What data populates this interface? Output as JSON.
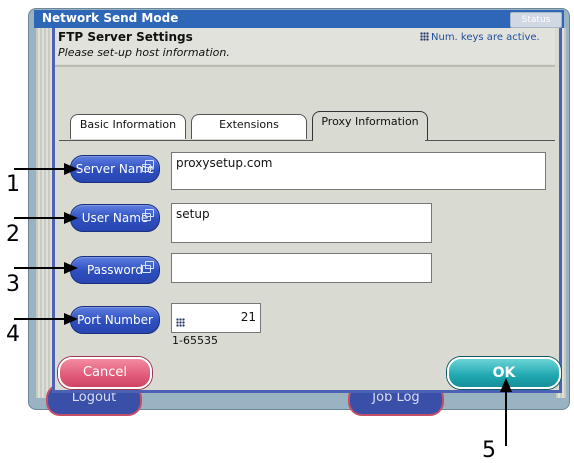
{
  "window": {
    "title": "Network Send Mode",
    "status_label": "Status"
  },
  "dialog": {
    "title": "FTP Server Settings",
    "subtitle": "Please set-up host information.",
    "num_keys_hint": "Num. keys are active."
  },
  "tabs": [
    {
      "label": "Basic Information",
      "active": false
    },
    {
      "label": "Extensions",
      "active": false
    },
    {
      "label": "Proxy Information",
      "active": true
    }
  ],
  "fields": {
    "server_name": {
      "button_label": "Server Name",
      "value": "proxysetup.com"
    },
    "user_name": {
      "button_label": "User Name",
      "value": "setup"
    },
    "password": {
      "button_label": "Password",
      "value": ""
    },
    "port_number": {
      "button_label": "Port Number",
      "value": "21",
      "range": "1-65535"
    }
  },
  "buttons": {
    "cancel": "Cancel",
    "ok": "OK",
    "logout": "Logout",
    "job_log": "Job Log"
  },
  "callouts": [
    "1",
    "2",
    "3",
    "4",
    "5"
  ],
  "colors": {
    "titlebar": "#2f67b8",
    "field_button": "#2d4fbf",
    "cancel": "#e05a78",
    "ok": "#20a7b0"
  }
}
